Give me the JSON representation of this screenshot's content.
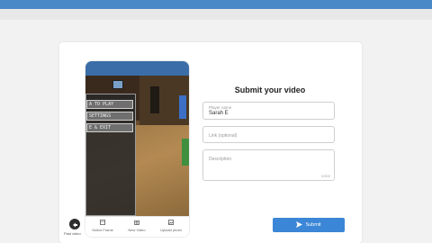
{
  "form": {
    "title": "Submit your video",
    "name_label": "Player name",
    "name_value": "Sarah E",
    "link_placeholder": "Link (optional)",
    "description_placeholder": "Description",
    "description_counter": "0/500",
    "submit_label": "Submit"
  },
  "game_menu": {
    "items": [
      "A TO PLAY",
      "SETTINGS",
      "E & EXIT"
    ]
  },
  "phone_toolbar": {
    "tools": [
      {
        "icon": "video-icon",
        "label": "Select Frame"
      },
      {
        "icon": "camera-icon",
        "label": "New Video"
      },
      {
        "icon": "image-icon",
        "label": "Upload photo"
      }
    ]
  },
  "nav": {
    "back_label": "Past video"
  },
  "colors": {
    "accent": "#3b86d6",
    "topbar": "#4a89c8"
  }
}
